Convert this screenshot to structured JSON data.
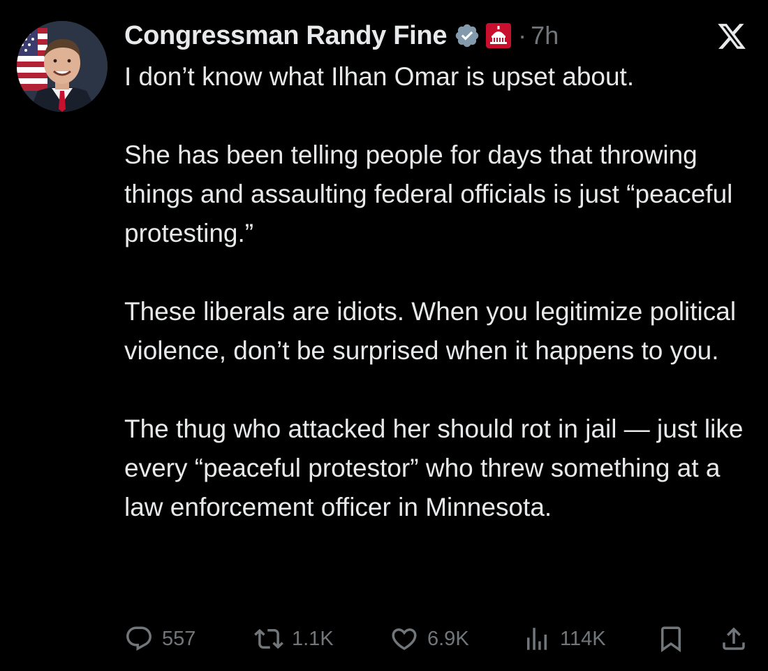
{
  "author": {
    "display_name": "Congressman Randy Fine",
    "verified_icon": "verified-badge-icon",
    "affiliation_icon": "us-house-capitol-icon",
    "avatar_icon": "profile-photo-avatar"
  },
  "meta": {
    "separator": "·",
    "timestamp": "7h"
  },
  "platform_icon": "x-logo-icon",
  "post": {
    "paragraphs": [
      "I don’t know what Ilhan Omar is upset about.",
      "She has been telling people for days that throwing things and assaulting federal officials is just “peaceful protesting.”",
      "These liberals are idiots.  When you legitimize political violence, don’t be surprised when it happens to you.",
      "The thug who attacked her should rot in jail — just like every “peaceful protestor” who threw something at a law enforcement officer in Minnesota."
    ]
  },
  "actions": {
    "reply": {
      "icon": "reply-icon",
      "count": "557"
    },
    "repost": {
      "icon": "repost-icon",
      "count": "1.1K"
    },
    "like": {
      "icon": "heart-icon",
      "count": "6.9K"
    },
    "views": {
      "icon": "views-chart-icon",
      "count": "114K"
    },
    "bookmark": {
      "icon": "bookmark-icon"
    },
    "share": {
      "icon": "share-icon"
    }
  },
  "colors": {
    "background": "#000000",
    "text_primary": "#e7e9ea",
    "text_secondary": "#71767b",
    "verified_badge": "#829aab",
    "affiliation_badge": "#c8102e"
  }
}
